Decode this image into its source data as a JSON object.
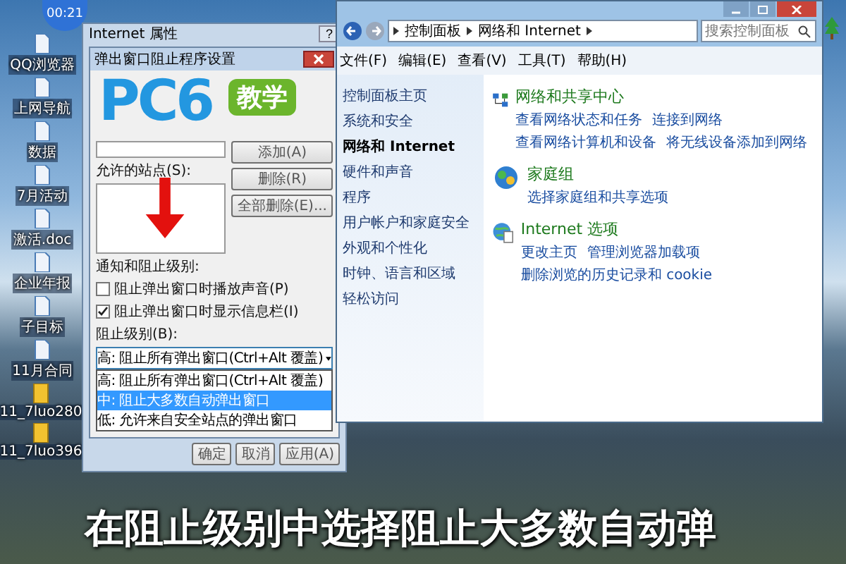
{
  "clock_badge": "00:21",
  "desktop_icons": [
    {
      "label": "QQ浏览器"
    },
    {
      "label": "上网导航"
    },
    {
      "label": "数据"
    },
    {
      "label": "7月活动"
    },
    {
      "label": "激活.doc"
    },
    {
      "label": "企业年报"
    },
    {
      "label": "子目标"
    },
    {
      "label": "11月合同"
    }
  ],
  "desktop_files": [
    {
      "label": "11_7luo280"
    },
    {
      "label": "11_7luo396"
    }
  ],
  "internet_options": {
    "title": "Internet 属性",
    "help": "?",
    "popup_settings": {
      "title": "弹出窗口阻止程序设置",
      "allowed_label": "允许的站点(S):",
      "side_buttons": [
        "添加(A)",
        "删除(R)",
        "全部删除(E)..."
      ],
      "notify_label": "通知和阻止级别:",
      "checkboxes": [
        {
          "label": "阻止弹出窗口时播放声音(P)",
          "checked": false
        },
        {
          "label": "阻止弹出窗口时显示信息栏(I)",
          "checked": true
        }
      ],
      "level_label": "阻止级别(B):",
      "level_value": "高: 阻止所有弹出窗口(Ctrl+Alt 覆盖)",
      "level_options": [
        {
          "label": "高: 阻止所有弹出窗口(Ctrl+Alt 覆盖)",
          "selected": false
        },
        {
          "label": "中: 阻止大多数自动弹出窗口",
          "selected": true
        },
        {
          "label": "低: 允许来自安全站点的弹出窗口",
          "selected": false
        }
      ]
    },
    "buttons": [
      "确定",
      "取消",
      "应用(A)"
    ]
  },
  "control_panel": {
    "breadcrumb": [
      "控制面板",
      "网络和 Internet"
    ],
    "search": {
      "placeholder": "搜索控制面板"
    },
    "menu": [
      "文件(F)",
      "编辑(E)",
      "查看(V)",
      "工具(T)",
      "帮助(H)"
    ],
    "sidebar": [
      {
        "label": "控制面板主页",
        "selected": false
      },
      {
        "label": "系统和安全",
        "selected": false
      },
      {
        "label": "网络和 Internet",
        "selected": true
      },
      {
        "label": "硬件和声音",
        "selected": false
      },
      {
        "label": "程序",
        "selected": false
      },
      {
        "label": "用户帐户和家庭安全",
        "selected": false
      },
      {
        "label": "外观和个性化",
        "selected": false
      },
      {
        "label": "时钟、语言和区域",
        "selected": false
      },
      {
        "label": "轻松访问",
        "selected": false
      }
    ],
    "categories": [
      {
        "kind": "network",
        "title": "网络和共享中心",
        "links": [
          "查看网络状态和任务",
          "连接到网络",
          "查看网络计算机和设备",
          "将无线设备添加到网络"
        ]
      },
      {
        "kind": "homegroup",
        "title": "家庭组",
        "links": [
          "选择家庭组和共享选项"
        ]
      },
      {
        "kind": "internet",
        "title": "Internet 选项",
        "links": [
          "更改主页",
          "管理浏览器加载项",
          "删除浏览的历史记录和 cookie"
        ]
      }
    ]
  },
  "logo": {
    "text": "PC6",
    "badge": "教学"
  },
  "caption": "在阻止级别中选择阻止大多数自动弹"
}
